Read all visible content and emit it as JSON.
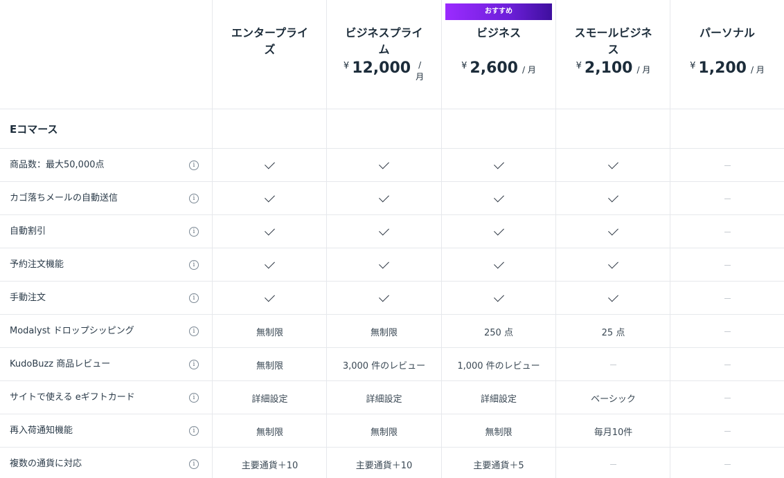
{
  "badge": "おすすめ",
  "plans": [
    {
      "name": "エンタープライズ",
      "currency": "",
      "amount": "",
      "per": ""
    },
    {
      "name": "ビジネスプライム",
      "currency": "¥",
      "amount": "12,000",
      "per": "/ 月"
    },
    {
      "name": "ビジネス",
      "currency": "¥",
      "amount": "2,600",
      "per": "/ 月"
    },
    {
      "name": "スモールビジネス",
      "currency": "¥",
      "amount": "2,100",
      "per": "/ 月"
    },
    {
      "name": "パーソナル",
      "currency": "¥",
      "amount": "1,200",
      "per": "/ 月"
    }
  ],
  "section_title": "Eコマース",
  "info_icon_glyph": "i",
  "rows": [
    {
      "feature": "商品数：最大50,000点",
      "cells": [
        {
          "check": true
        },
        {
          "check": true
        },
        {
          "check": true
        },
        {
          "check": true
        },
        {
          "dash": true
        }
      ]
    },
    {
      "feature": "カゴ落ちメールの自動送信",
      "cells": [
        {
          "check": true
        },
        {
          "check": true
        },
        {
          "check": true
        },
        {
          "check": true
        },
        {
          "dash": true
        }
      ]
    },
    {
      "feature": "自動割引",
      "cells": [
        {
          "check": true
        },
        {
          "check": true
        },
        {
          "check": true
        },
        {
          "check": true
        },
        {
          "dash": true
        }
      ]
    },
    {
      "feature": "予約注文機能",
      "cells": [
        {
          "check": true
        },
        {
          "check": true
        },
        {
          "check": true
        },
        {
          "check": true
        },
        {
          "dash": true
        }
      ]
    },
    {
      "feature": "手動注文",
      "cells": [
        {
          "check": true
        },
        {
          "check": true
        },
        {
          "check": true
        },
        {
          "check": true
        },
        {
          "dash": true
        }
      ]
    },
    {
      "feature": "Modalyst ドロップシッピング",
      "cells": [
        {
          "text": "無制限"
        },
        {
          "text": "無制限"
        },
        {
          "text": "250 点"
        },
        {
          "text": "25 点"
        },
        {
          "dash": true
        }
      ]
    },
    {
      "feature": "KudoBuzz 商品レビュー",
      "cells": [
        {
          "text": "無制限"
        },
        {
          "text": "3,000 件のレビュー"
        },
        {
          "text": "1,000 件のレビュー"
        },
        {
          "dash": true
        },
        {
          "dash": true
        }
      ]
    },
    {
      "feature": "サイトで使える eギフトカード",
      "cells": [
        {
          "text": "詳細設定"
        },
        {
          "text": "詳細設定"
        },
        {
          "text": "詳細設定"
        },
        {
          "text": "ベーシック"
        },
        {
          "dash": true
        }
      ]
    },
    {
      "feature": "再入荷通知機能",
      "cells": [
        {
          "text": "無制限"
        },
        {
          "text": "無制限"
        },
        {
          "text": "無制限"
        },
        {
          "text": "毎月10件"
        },
        {
          "dash": true
        }
      ]
    },
    {
      "feature": "複数の通貨に対応",
      "cells": [
        {
          "text": "主要通貨＋10"
        },
        {
          "text": "主要通貨＋10"
        },
        {
          "text": "主要通貨＋5"
        },
        {
          "dash": true
        },
        {
          "dash": true
        }
      ]
    }
  ]
}
